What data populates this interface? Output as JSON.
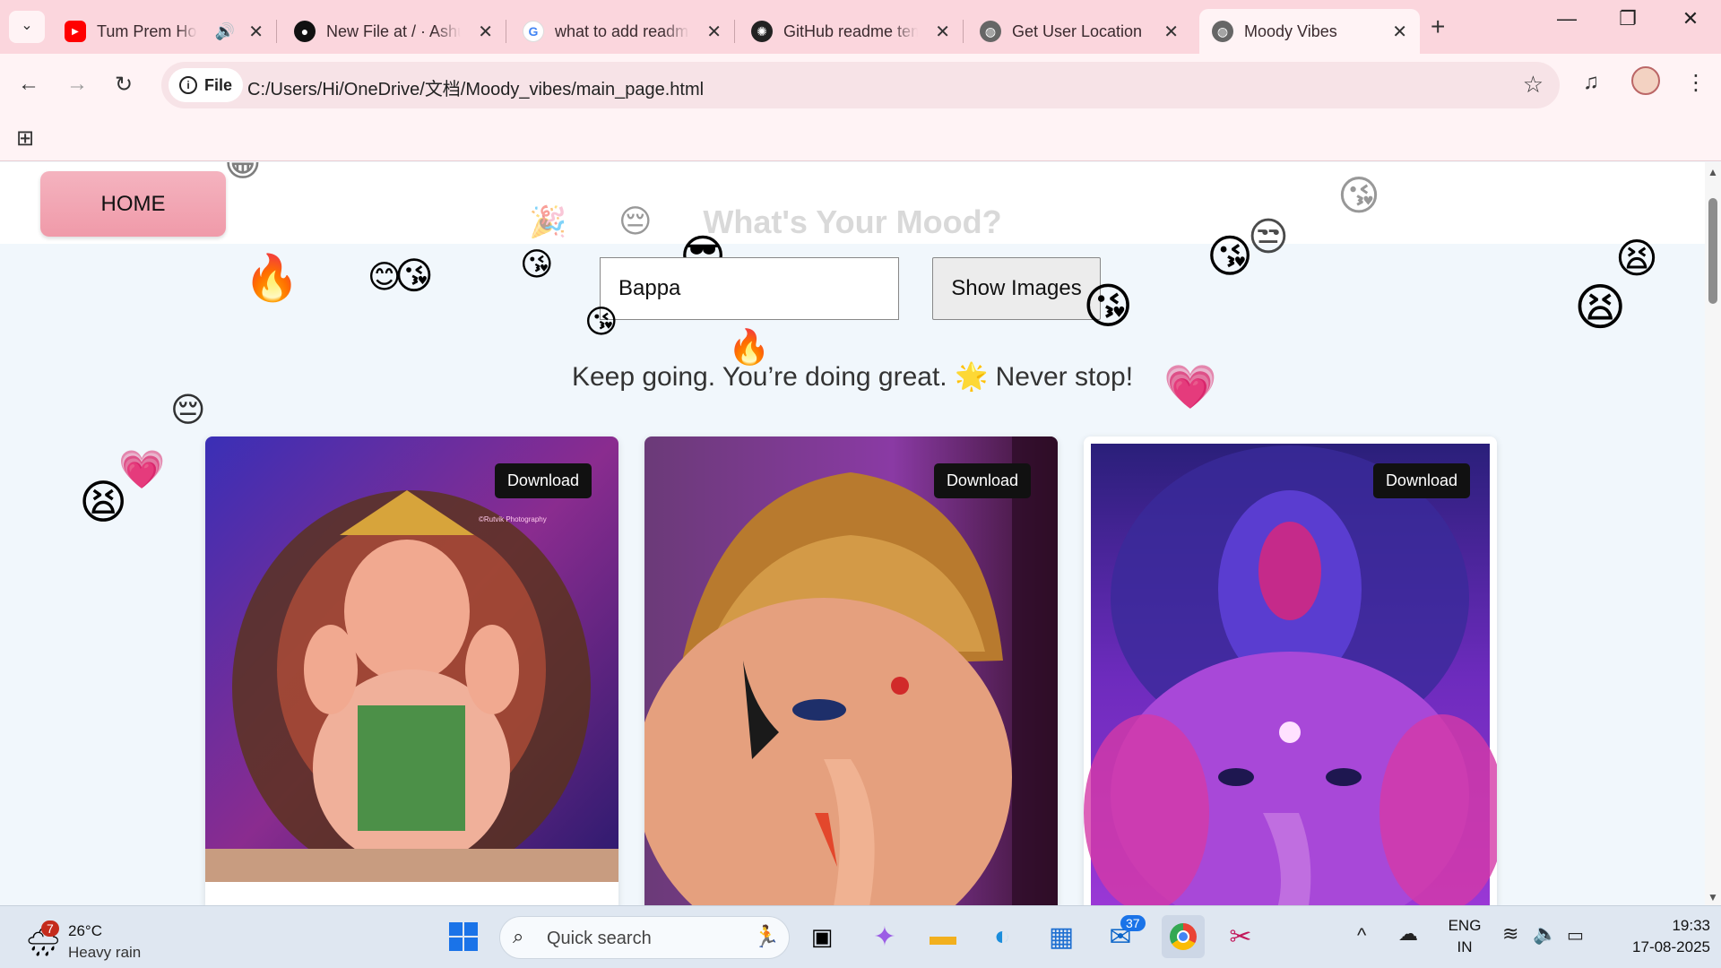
{
  "browser": {
    "tabs": [
      {
        "title": "Tum Prem Ho",
        "favicon": "youtube-icon",
        "color": "#ff0000"
      },
      {
        "title": "New File at / · Ashu",
        "favicon": "github-icon",
        "color": "#111111"
      },
      {
        "title": "what to add readme",
        "favicon": "google-icon",
        "color": "#4285f4"
      },
      {
        "title": "GitHub readme template",
        "favicon": "chatgpt-icon",
        "color": "#222222"
      },
      {
        "title": "Get User Location",
        "favicon": "globe-icon",
        "color": "#555555"
      },
      {
        "title": "Moody Vibes",
        "favicon": "globe-icon",
        "color": "#555555"
      }
    ],
    "address_chip": "File",
    "url": "C:/Users/Hi/OneDrive/文档/Moody_vibes/main_page.html"
  },
  "page": {
    "home_label": "HOME",
    "title": "What's Your Mood?",
    "mood_input_value": "Bappa",
    "show_button": "Show Images",
    "motivation": "Keep going. You’re doing great. 🌟 Never stop!",
    "cards": [
      {
        "download_label": "Download",
        "subject": "ganesha-idol-colorful",
        "watermark": "©Rutvik Photography"
      },
      {
        "download_label": "Download",
        "subject": "ganesha-idol-golden-crown"
      },
      {
        "download_label": "Download",
        "subject": "ganesha-idol-purple"
      }
    ]
  },
  "taskbar": {
    "weather_temp": "26°C",
    "weather_desc": "Heavy rain",
    "weather_badge": "7",
    "search_placeholder": "Quick search",
    "mail_badge": "37",
    "lang_top": "ENG",
    "lang_bottom": "IN",
    "time": "19:33",
    "date": "17-08-2025"
  }
}
